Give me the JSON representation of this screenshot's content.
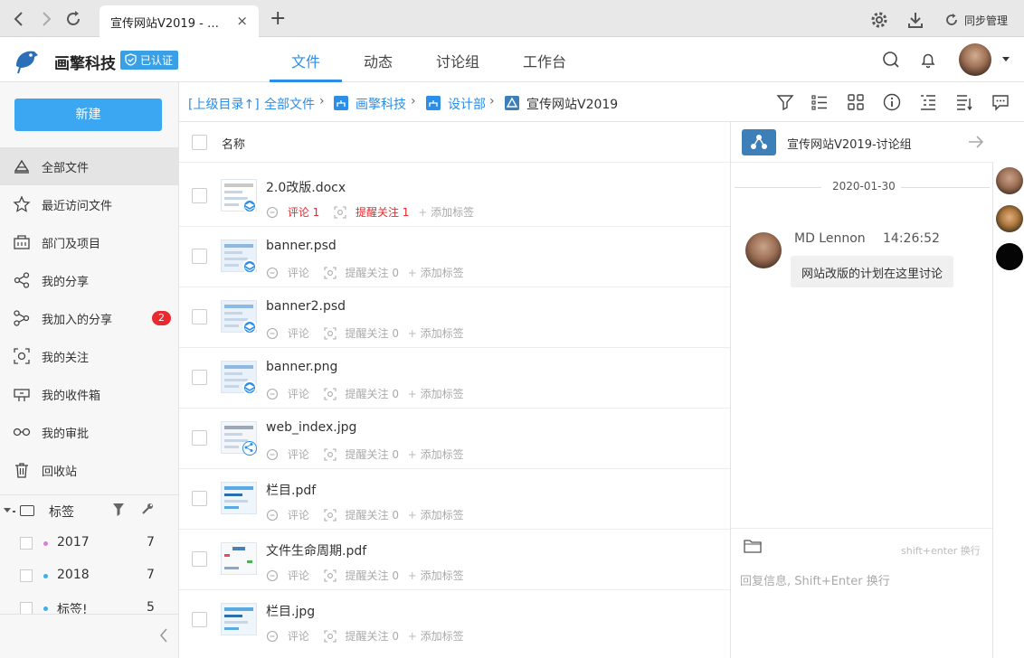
{
  "browser": {
    "tab_title": "宣传网站V2019 - 巴...",
    "tab_close": "×",
    "new_tab": "+",
    "sync_label": "同步管理"
  },
  "header": {
    "brand": "画擎科技",
    "verified": "已认证",
    "tabs": [
      {
        "label": "文件",
        "active": true
      },
      {
        "label": "动态",
        "active": false
      },
      {
        "label": "讨论组",
        "active": false
      },
      {
        "label": "工作台",
        "active": false
      }
    ]
  },
  "sidebar": {
    "new_button": "新建",
    "items": [
      {
        "label": "全部文件",
        "icon": "all-files-icon",
        "active": true
      },
      {
        "label": "最近访问文件",
        "icon": "star-icon",
        "active": false
      },
      {
        "label": "部门及项目",
        "icon": "department-icon",
        "active": false
      },
      {
        "label": "我的分享",
        "icon": "share-icon",
        "active": false
      },
      {
        "label": "我加入的分享",
        "icon": "joined-share-icon",
        "active": false,
        "badge": "2"
      },
      {
        "label": "我的关注",
        "icon": "focus-icon",
        "active": false
      },
      {
        "label": "我的收件箱",
        "icon": "inbox-icon",
        "active": false
      },
      {
        "label": "我的审批",
        "icon": "approval-icon",
        "active": false
      },
      {
        "label": "回收站",
        "icon": "trash-icon",
        "active": false
      }
    ],
    "tags_label": "标签",
    "tags": [
      {
        "name": "2017",
        "count": "7",
        "color": "#d87ddb"
      },
      {
        "name": "2018",
        "count": "7",
        "color": "#3ab0e8"
      },
      {
        "name": "标签!",
        "count": "5",
        "color": "#3ab0e8"
      }
    ]
  },
  "breadcrumb": {
    "up": "[上级目录↑]",
    "items": [
      "全部文件",
      "画擎科技",
      "设计部",
      "宣传网站V2019"
    ],
    "separator": "›"
  },
  "file_list": {
    "header_name": "名称",
    "files": [
      {
        "name": "2.0改版.docx",
        "comment": "评论 1",
        "remind": "提醒关注 1",
        "tag": "添加标签",
        "highlight": true,
        "overlay": "layers"
      },
      {
        "name": "banner.psd",
        "comment": "评论",
        "remind": "提醒关注 0",
        "tag": "添加标签",
        "highlight": false,
        "overlay": "layers"
      },
      {
        "name": "banner2.psd",
        "comment": "评论",
        "remind": "提醒关注 0",
        "tag": "添加标签",
        "highlight": false,
        "overlay": "layers"
      },
      {
        "name": "banner.png",
        "comment": "评论",
        "remind": "提醒关注 0",
        "tag": "添加标签",
        "highlight": false,
        "overlay": "layers"
      },
      {
        "name": "web_index.jpg",
        "comment": "评论",
        "remind": "提醒关注 0",
        "tag": "添加标签",
        "highlight": false,
        "overlay": "share"
      },
      {
        "name": "栏目.pdf",
        "comment": "评论",
        "remind": "提醒关注 0",
        "tag": "添加标签",
        "highlight": false,
        "overlay": "none"
      },
      {
        "name": "文件生命周期.pdf",
        "comment": "评论",
        "remind": "提醒关注 0",
        "tag": "添加标签",
        "highlight": false,
        "overlay": "none"
      },
      {
        "name": "栏目.jpg",
        "comment": "评论",
        "remind": "提醒关注 0",
        "tag": "添加标签",
        "highlight": false,
        "overlay": "none"
      }
    ]
  },
  "chat": {
    "title": "宣传网站V2019-讨论组",
    "date": "2020-01-30",
    "messages": [
      {
        "author": "MD Lennon",
        "time": "14:26:52",
        "text": "网站改版的计划在这里讨论"
      }
    ],
    "hint": "shift+enter 换行",
    "reply_placeholder": "回复信息, Shift+Enter 换行"
  },
  "colors": {
    "accent": "#2b8ee8",
    "new_button": "#3ba7f2",
    "badge": "#e8292f",
    "highlight_text": "#e8292f"
  }
}
